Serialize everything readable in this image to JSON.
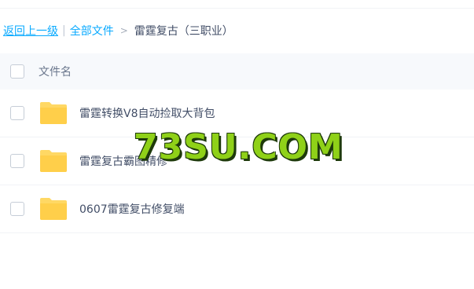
{
  "breadcrumb": {
    "back_label": "返回上一级",
    "separator_bar": "|",
    "all_files_label": "全部文件",
    "separator_arrow": ">",
    "current_label": "雷霆复古（三职业）"
  },
  "list_header": {
    "name_column_label": "文件名"
  },
  "files": [
    {
      "name": "雷霆转换V8自动捡取大背包",
      "icon": "folder-icon"
    },
    {
      "name": "雷霆复古霸图精修",
      "icon": "folder-icon"
    },
    {
      "name": "0607雷霆复古修复端",
      "icon": "folder-icon"
    }
  ],
  "watermark": {
    "text": "73SU.COM"
  },
  "colors": {
    "link": "#09aaff",
    "text": "#424e67",
    "folder": "#ffd864",
    "header_bg": "#f7f9fc",
    "watermark_fill": "#8fd118"
  }
}
